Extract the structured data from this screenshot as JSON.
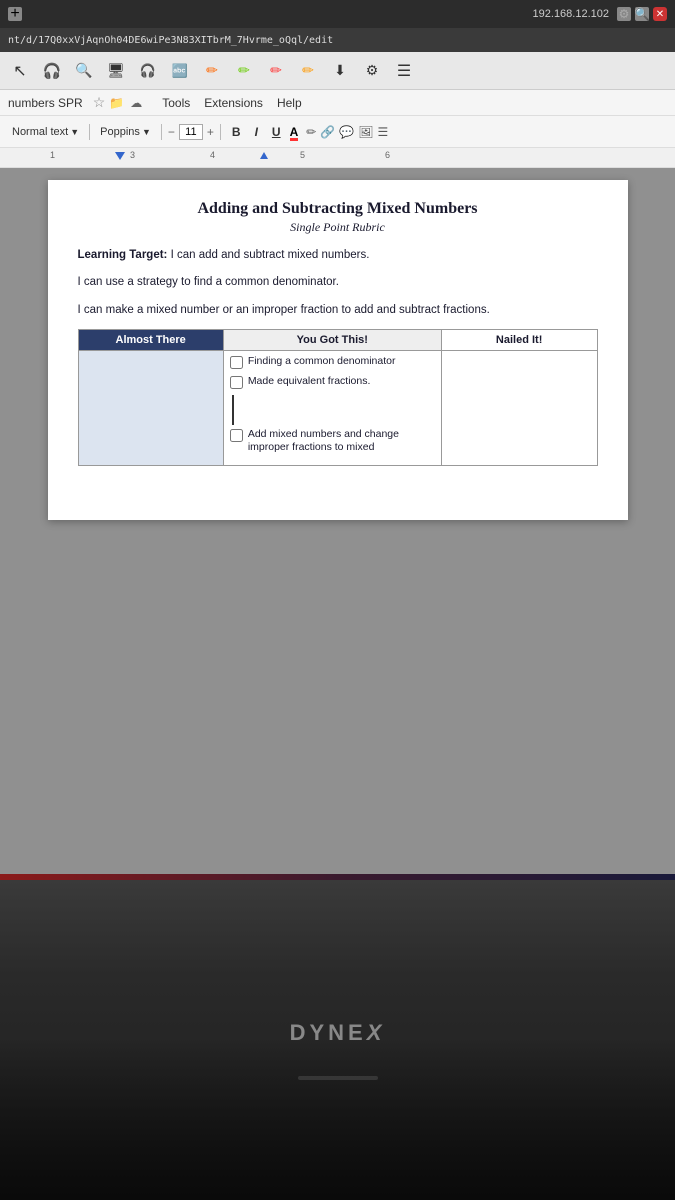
{
  "browser": {
    "ip_address": "192.168.12.102",
    "url": "nt/d/17Q0xxVjAqnOh04DE6wiPe3N83XITbrM_7Hvrme_oQql/edit"
  },
  "menubar": {
    "title": "numbers SPR",
    "items": [
      "Tools",
      "Extensions",
      "Help"
    ]
  },
  "formatbar": {
    "style": "Normal text",
    "font": "Poppins",
    "size": "11",
    "bold": "B",
    "italic": "I",
    "underline": "U"
  },
  "document": {
    "title": "Adding and Subtracting Mixed Numbers",
    "subtitle": "Single Point Rubric",
    "learning_target_label": "Learning Target:",
    "learning_target_text": " I can add and subtract mixed numbers.",
    "line2": "I can use a strategy to find a common denominator.",
    "line3": "I can make a mixed number or an improper fraction to add and subtract fractions.",
    "rubric": {
      "col1_header": "Almost There",
      "col2_header": "You Got This!",
      "col3_header": "Nailed It!",
      "criteria": [
        "Finding a common denominator",
        "Made equivalent fractions.",
        "Add mixed numbers and change improper fractions to mixed"
      ]
    }
  },
  "monitor": {
    "brand": "DYNEX"
  }
}
